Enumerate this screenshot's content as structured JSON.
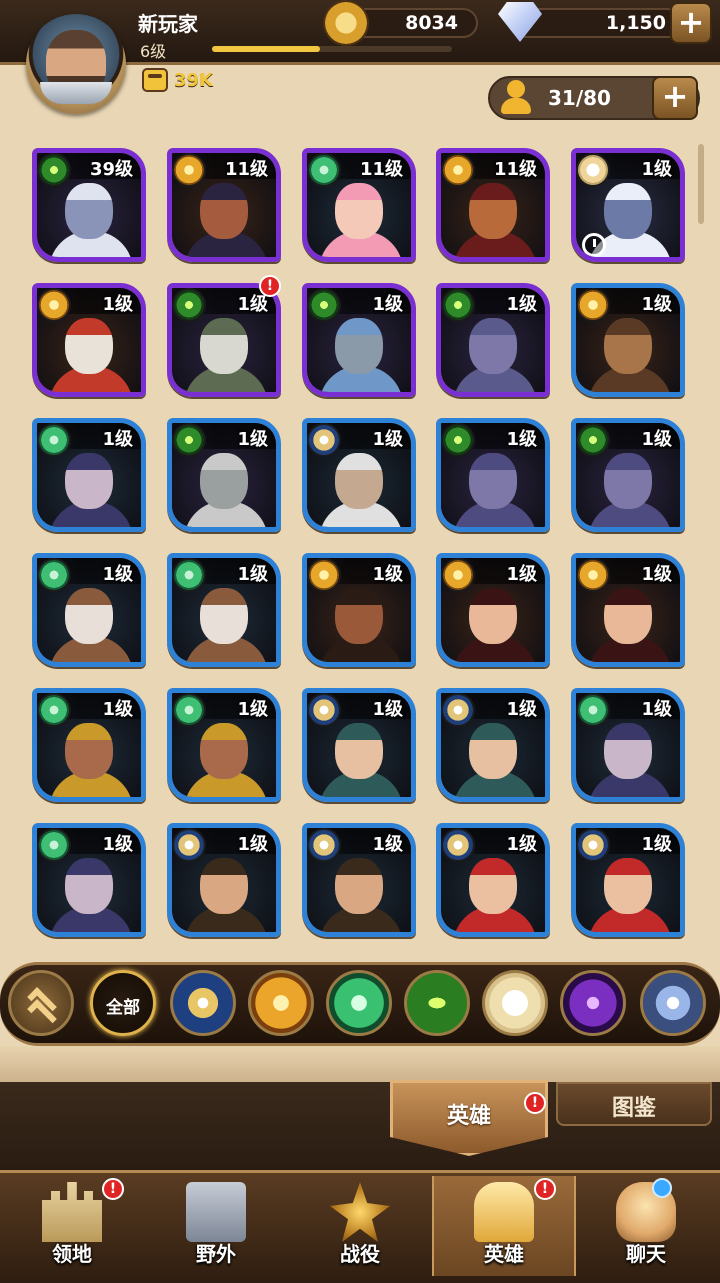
{
  "player": {
    "name": "新玩家",
    "level": "6级",
    "xp_fraction": 0.45,
    "power": "39K"
  },
  "currency": {
    "gold": "8034",
    "gems": "1,150"
  },
  "hero_count": "31/80",
  "heroes": [
    {
      "level": "39级",
      "frame": "purple",
      "faction": "eye",
      "skin": "#8a93b8",
      "hair": "#dfe3ef",
      "badge": false,
      "clock": false
    },
    {
      "level": "11级",
      "frame": "purple",
      "faction": "sun",
      "skin": "#a45b3e",
      "hair": "#2a2440",
      "badge": false,
      "clock": false
    },
    {
      "level": "11级",
      "frame": "purple",
      "faction": "forest",
      "skin": "#f4c9b8",
      "hair": "#f39ab5",
      "badge": false,
      "clock": false
    },
    {
      "level": "11级",
      "frame": "purple",
      "faction": "sun",
      "skin": "#b86a3a",
      "hair": "#6a1c1c",
      "badge": false,
      "clock": false
    },
    {
      "level": "1级",
      "frame": "purple",
      "faction": "light",
      "skin": "#6c7aa8",
      "hair": "#e9eef8",
      "badge": false,
      "clock": true
    },
    {
      "level": "1级",
      "frame": "purple",
      "faction": "sun",
      "skin": "#e9e2d8",
      "hair": "#c23a2a",
      "badge": false,
      "clock": false
    },
    {
      "level": "1级",
      "frame": "purple",
      "faction": "eye",
      "skin": "#d8d8d0",
      "hair": "#5d6b52",
      "badge": true,
      "clock": false
    },
    {
      "level": "1级",
      "frame": "purple",
      "faction": "eye",
      "skin": "#8a9aa8",
      "hair": "#6f98c8",
      "badge": false,
      "clock": false
    },
    {
      "level": "1级",
      "frame": "purple",
      "faction": "eye",
      "skin": "#7e78a8",
      "hair": "#5b5a8c",
      "badge": false,
      "clock": false
    },
    {
      "level": "1级",
      "frame": "blue",
      "faction": "sun",
      "skin": "#a8744a",
      "hair": "#5a3a24",
      "badge": false,
      "clock": false
    },
    {
      "level": "1级",
      "frame": "blue",
      "faction": "forest",
      "skin": "#c9b6c8",
      "hair": "#3a3868",
      "badge": false,
      "clock": false
    },
    {
      "level": "1级",
      "frame": "blue",
      "faction": "eye",
      "skin": "#9aa0a0",
      "hair": "#c9c9c9",
      "badge": false,
      "clock": false
    },
    {
      "level": "1级",
      "frame": "blue",
      "faction": "star",
      "skin": "#c4a890",
      "hair": "#e0e0e0",
      "badge": false,
      "clock": false
    },
    {
      "level": "1级",
      "frame": "blue",
      "faction": "eye",
      "skin": "#7e78a8",
      "hair": "#4d4b80",
      "badge": false,
      "clock": false
    },
    {
      "level": "1级",
      "frame": "blue",
      "faction": "eye",
      "skin": "#7e78a8",
      "hair": "#4d4b80",
      "badge": false,
      "clock": false
    },
    {
      "level": "1级",
      "frame": "blue",
      "faction": "forest",
      "skin": "#e8e0d8",
      "hair": "#8a5a3c",
      "badge": false,
      "clock": false
    },
    {
      "level": "1级",
      "frame": "blue",
      "faction": "forest",
      "skin": "#e8e0d8",
      "hair": "#8a5a3c",
      "badge": false,
      "clock": false
    },
    {
      "level": "1级",
      "frame": "blue",
      "faction": "sun",
      "skin": "#9a5a3a",
      "hair": "#2a1c14",
      "badge": false,
      "clock": false
    },
    {
      "level": "1级",
      "frame": "blue",
      "faction": "sun",
      "skin": "#e8b898",
      "hair": "#3a1414",
      "badge": false,
      "clock": false
    },
    {
      "level": "1级",
      "frame": "blue",
      "faction": "sun",
      "skin": "#e8b898",
      "hair": "#3a1414",
      "badge": false,
      "clock": false
    },
    {
      "level": "1级",
      "frame": "blue",
      "faction": "forest",
      "skin": "#a86a4a",
      "hair": "#c99a2a",
      "badge": false,
      "clock": false
    },
    {
      "level": "1级",
      "frame": "blue",
      "faction": "forest",
      "skin": "#a86a4a",
      "hair": "#c99a2a",
      "badge": false,
      "clock": false
    },
    {
      "level": "1级",
      "frame": "blue",
      "faction": "star",
      "skin": "#e6c0a0",
      "hair": "#2e5a5a",
      "badge": false,
      "clock": false
    },
    {
      "level": "1级",
      "frame": "blue",
      "faction": "star",
      "skin": "#e6c0a0",
      "hair": "#2e5a5a",
      "badge": false,
      "clock": false
    },
    {
      "level": "1级",
      "frame": "blue",
      "faction": "forest",
      "skin": "#c9b6c8",
      "hair": "#3a3868",
      "badge": false,
      "clock": false
    },
    {
      "level": "1级",
      "frame": "blue",
      "faction": "forest",
      "skin": "#c9b6c8",
      "hair": "#3a3868",
      "badge": false,
      "clock": false
    },
    {
      "level": "1级",
      "frame": "blue",
      "faction": "star",
      "skin": "#d9a882",
      "hair": "#3a2a1c",
      "badge": false,
      "clock": false
    },
    {
      "level": "1级",
      "frame": "blue",
      "faction": "star",
      "skin": "#d9a882",
      "hair": "#3a2a1c",
      "badge": false,
      "clock": false
    },
    {
      "level": "1级",
      "frame": "blue",
      "faction": "star",
      "skin": "#eac0a0",
      "hair": "#c22a2a",
      "badge": false,
      "clock": false
    },
    {
      "level": "1级",
      "frame": "blue",
      "faction": "star",
      "skin": "#eac0a0",
      "hair": "#c22a2a",
      "badge": false,
      "clock": false
    }
  ],
  "filters": {
    "all_label": "全部",
    "icons": [
      "collapse-icon",
      "all",
      "star-faction-icon",
      "sun-faction-icon",
      "forest-faction-icon",
      "eye-faction-icon",
      "light-faction-icon",
      "dark-faction-icon",
      "celestial-faction-icon"
    ]
  },
  "tabs": {
    "hero": "英雄",
    "codex": "图鉴"
  },
  "nav": [
    {
      "label": "领地",
      "icon": "castle-icon",
      "badge": true,
      "active": false
    },
    {
      "label": "野外",
      "icon": "scroll-icon",
      "badge": false,
      "active": false
    },
    {
      "label": "战役",
      "icon": "swords-icon",
      "badge": false,
      "active": false
    },
    {
      "label": "英雄",
      "icon": "helmet-icon",
      "badge": true,
      "active": true
    },
    {
      "label": "聊天",
      "icon": "chat-icon",
      "badge": false,
      "active": false,
      "dot": true
    }
  ],
  "colors": {
    "purple_frame": "#7a2fd2",
    "blue_frame": "#2d82d8",
    "badge_red": "#e02424",
    "level_gold": "#f0c437"
  }
}
